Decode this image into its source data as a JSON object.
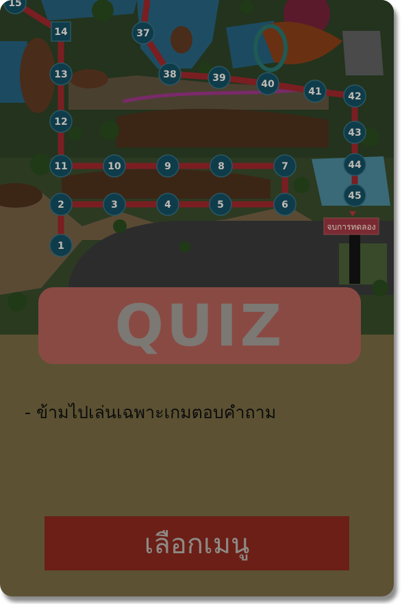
{
  "board": {
    "stops": [
      "1",
      "2",
      "3",
      "4",
      "5",
      "6",
      "7",
      "8",
      "9",
      "10",
      "11",
      "12",
      "13",
      "14",
      "15",
      "37",
      "38",
      "39",
      "40",
      "41",
      "42",
      "43",
      "44",
      "45"
    ],
    "finish_label": "จบการทดลอง"
  },
  "quiz": {
    "title": "QUIZ",
    "description": "- ข้ามไปเล่นเฉพาะเกมตอบคำถาม",
    "menu_button_label": "เลือกเมนู"
  },
  "colors": {
    "card_background": "#5c5233",
    "quiz_banner": "#8a4a44",
    "menu_button": "#6b1f17",
    "stop_marker": "#0f3c4a",
    "path": "#7a1e22"
  }
}
